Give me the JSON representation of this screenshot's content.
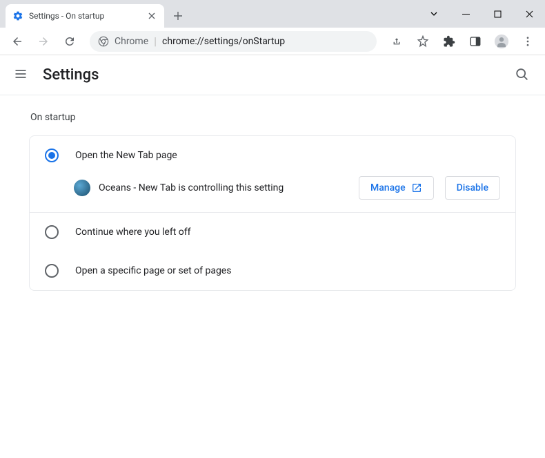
{
  "titlebar": {
    "tab_title": "Settings - On startup"
  },
  "omnibox": {
    "scheme_label": "Chrome",
    "url": "chrome://settings/onStartup"
  },
  "settings": {
    "title": "Settings",
    "section_title": "On startup",
    "option1": "Open the New Tab page",
    "extension_notice": "Oceans - New Tab is controlling this setting",
    "manage_label": "Manage",
    "disable_label": "Disable",
    "option2": "Continue where you left off",
    "option3": "Open a specific page or set of pages"
  }
}
